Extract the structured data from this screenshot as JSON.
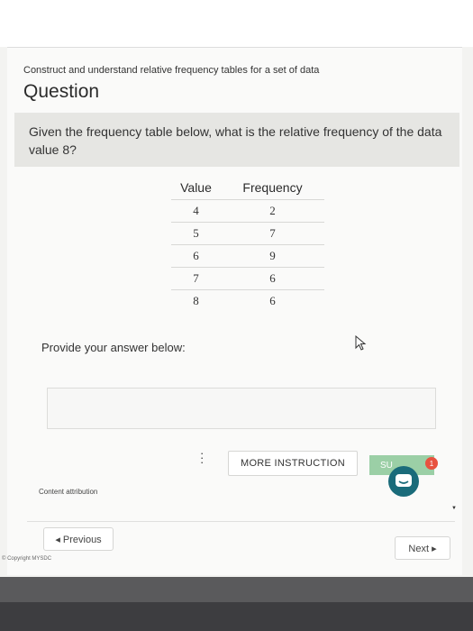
{
  "header": {
    "subtitle": "Construct and understand relative frequency tables for a set of data",
    "title": "Question"
  },
  "question": {
    "text": "Given the frequency table below, what is the relative frequency of the data value 8?"
  },
  "table": {
    "headers": [
      "Value",
      "Frequency"
    ],
    "rows": [
      {
        "value": "4",
        "frequency": "2"
      },
      {
        "value": "5",
        "frequency": "7"
      },
      {
        "value": "6",
        "frequency": "9"
      },
      {
        "value": "7",
        "frequency": "6"
      },
      {
        "value": "8",
        "frequency": "6"
      }
    ]
  },
  "answer": {
    "label": "Provide your answer below:",
    "value": ""
  },
  "actions": {
    "more_instruction": "MORE INSTRUCTION",
    "submit": "SU",
    "badge_count": "1",
    "attribution": "Content attribution",
    "previous": "◂ Previous",
    "next": "Next ▸"
  },
  "footer": {
    "copyright": "© Copyright MYSDC"
  }
}
